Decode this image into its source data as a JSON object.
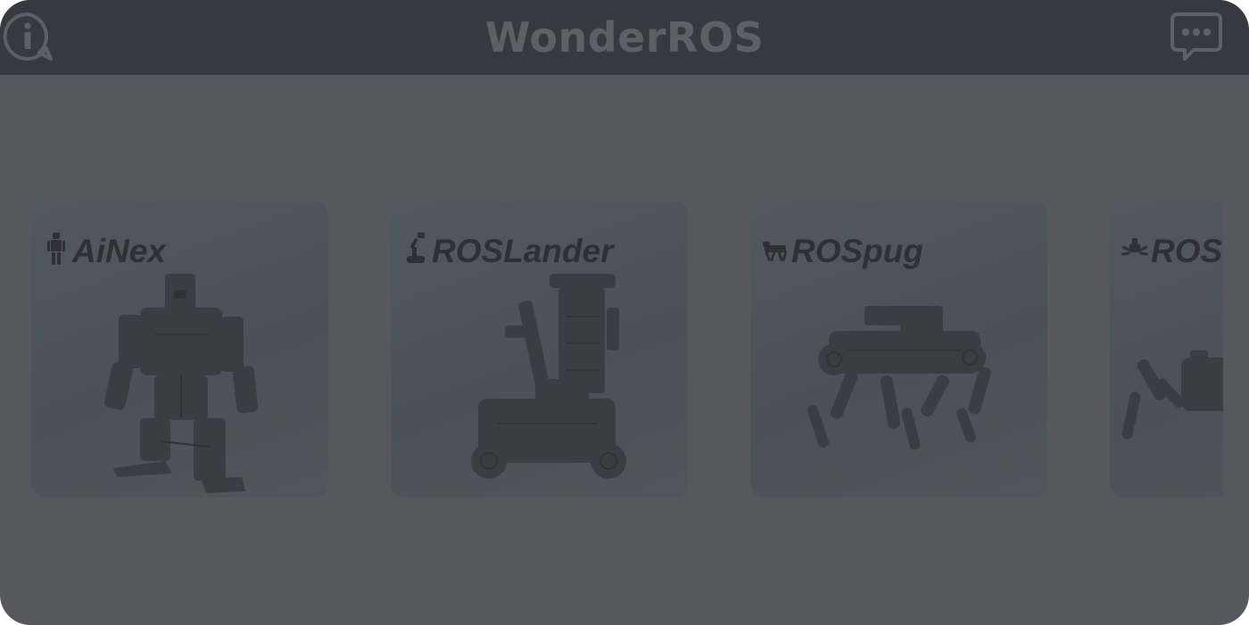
{
  "header": {
    "title": "WonderROS",
    "info_icon": "info-icon",
    "chat_icon": "chat-bubble-icon"
  },
  "robots": [
    {
      "name": "AiNex",
      "icon": "humanoid-robot-icon"
    },
    {
      "name": "ROSLander",
      "icon": "robot-arm-icon"
    },
    {
      "name": "ROSpug",
      "icon": "robot-dog-icon"
    },
    {
      "name": "ROS",
      "icon": "hexapod-robot-icon"
    }
  ],
  "colors": {
    "background": "#56585d",
    "header": "#363941",
    "title": "#5f6066",
    "card": "#50555c",
    "text": "#2e3036"
  }
}
